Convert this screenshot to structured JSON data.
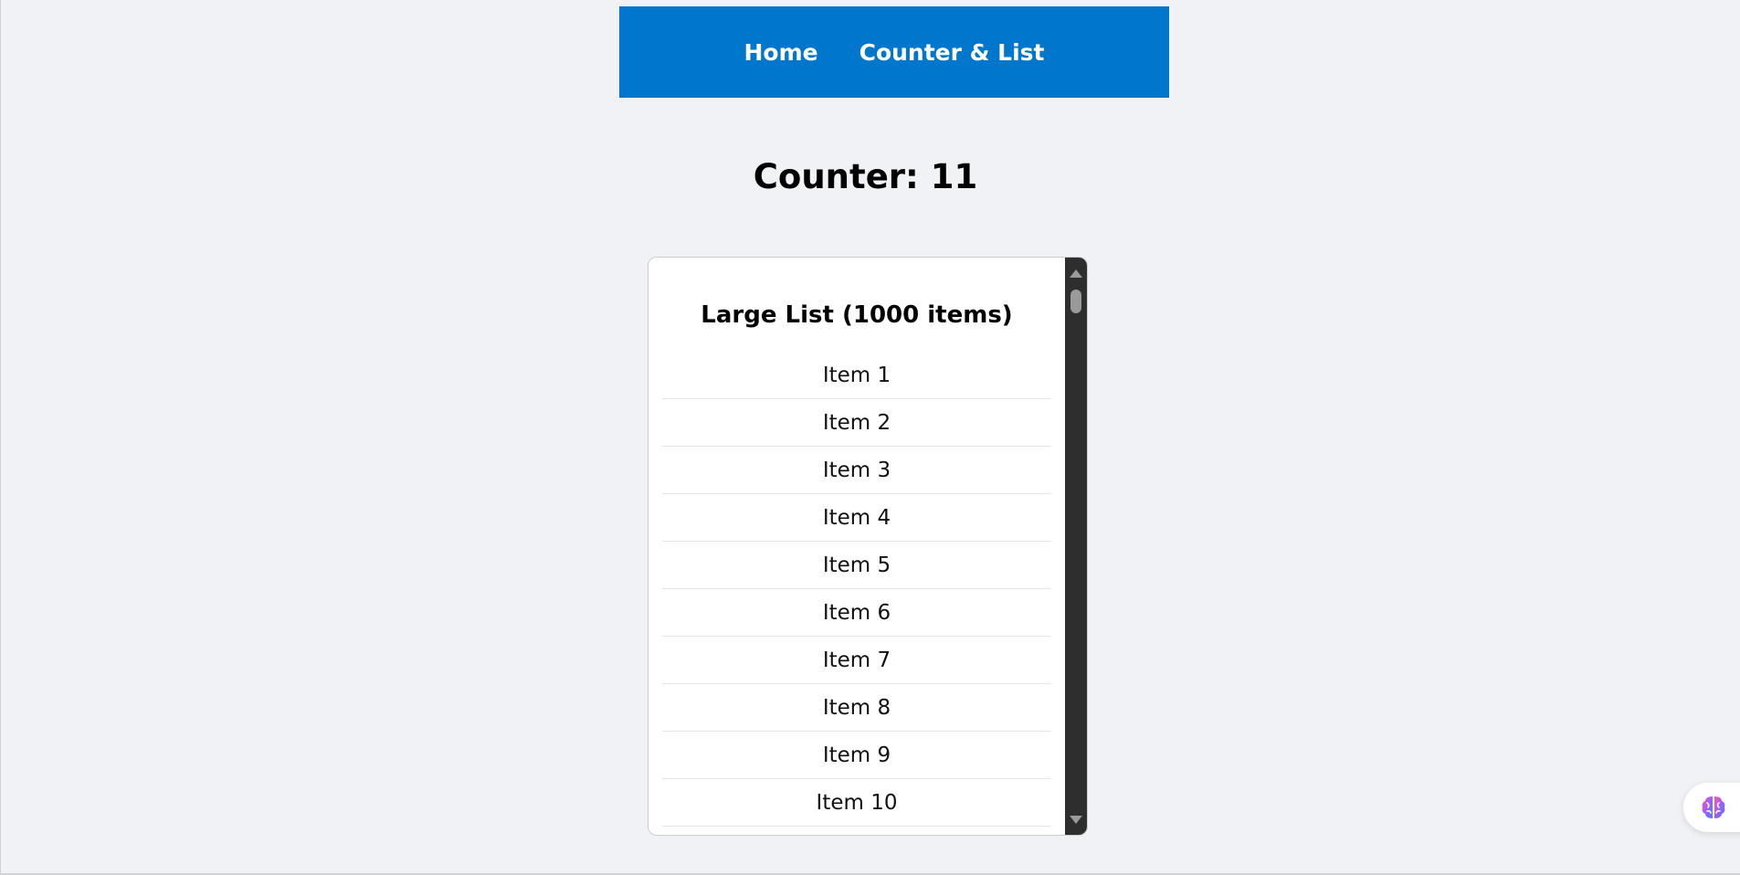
{
  "nav": {
    "links": [
      "Home",
      "Counter & List"
    ],
    "background_color": "#0077cc"
  },
  "counter": {
    "label": "Counter: 11",
    "value": 11
  },
  "list": {
    "title": "Large List (1000 items)",
    "visible_items": [
      "Item 1",
      "Item 2",
      "Item 3",
      "Item 4",
      "Item 5",
      "Item 6",
      "Item 7",
      "Item 8",
      "Item 9",
      "Item 10"
    ]
  },
  "assistant": {
    "icon": "brain-icon"
  },
  "colors": {
    "page_background": "#f0f2f5",
    "scrollbar": "#2e2e2e"
  }
}
